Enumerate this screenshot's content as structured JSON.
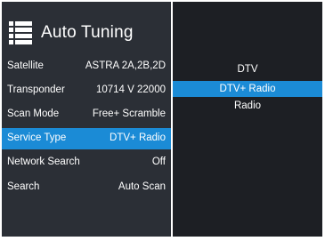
{
  "title": "Auto Tuning",
  "icons": {
    "menu": "list-menu-icon"
  },
  "colors": {
    "accent": "#1b8bd6",
    "panel": "#2b2f36",
    "dropdown": "#1d1f24"
  },
  "settings": [
    {
      "label": "Satellite",
      "value": "ASTRA 2A,2B,2D"
    },
    {
      "label": "Transponder",
      "value": "10714 V 22000"
    },
    {
      "label": "Scan Mode",
      "value": "Free+ Scramble"
    },
    {
      "label": "Service Type",
      "value": "DTV+ Radio",
      "selected": true
    },
    {
      "label": "Network Search",
      "value": "Off"
    },
    {
      "label": "Search",
      "value": "Auto Scan"
    }
  ],
  "service_type_options": [
    {
      "label": "DTV"
    },
    {
      "label": "DTV+ Radio",
      "selected": true
    },
    {
      "label": "Radio"
    }
  ]
}
